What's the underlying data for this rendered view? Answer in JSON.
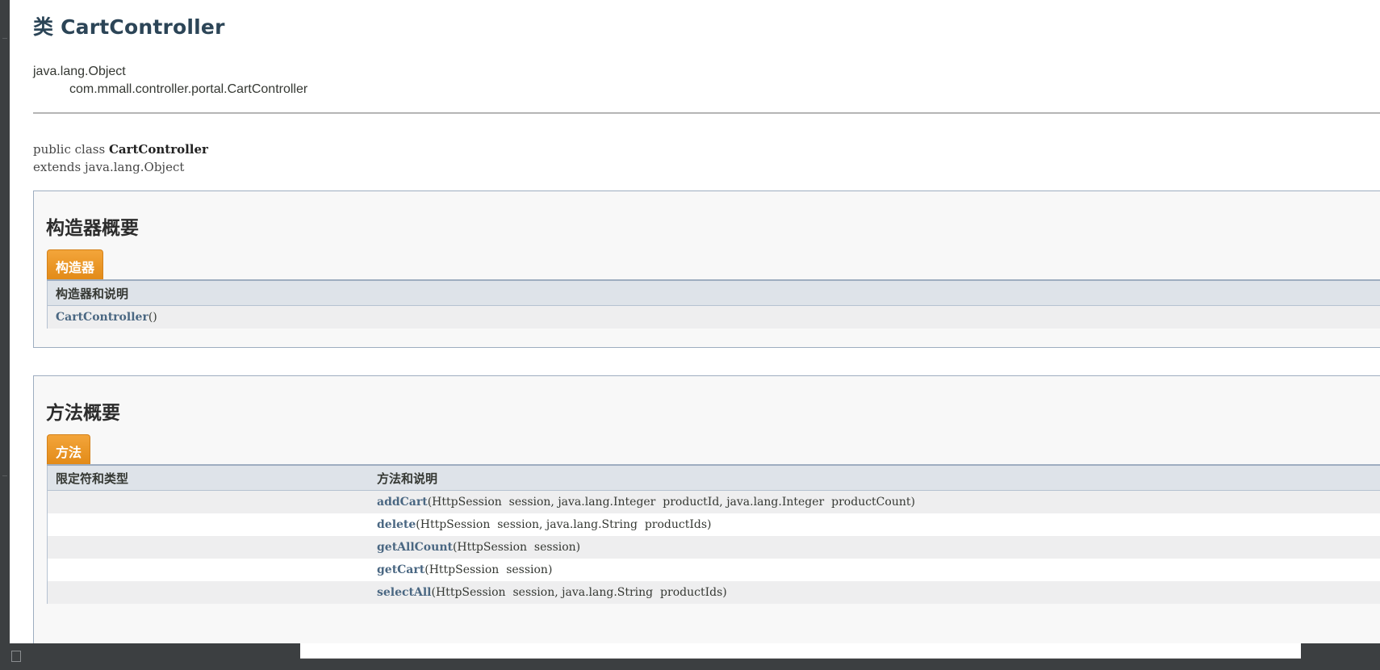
{
  "doc": {
    "title": "类 CartController",
    "inheritance": {
      "root": "java.lang.Object",
      "child": "com.mmall.controller.portal.CartController"
    },
    "signature": {
      "prefix": "public class ",
      "name": "CartController",
      "extends_line": "extends java.lang.Object"
    }
  },
  "constructor_summary": {
    "heading": "构造器概要",
    "tab_label": "构造器",
    "column_header": "构造器和说明",
    "rows": [
      {
        "name": "CartController",
        "params": "()"
      }
    ]
  },
  "method_summary": {
    "heading": "方法概要",
    "tab_label": "方法",
    "column_headers": [
      "限定符和类型",
      "方法和说明"
    ],
    "rows": [
      {
        "modifier": "",
        "name": "addCart",
        "params": "(HttpSession  session, java.lang.Integer  productId, java.lang.Integer  productCount)"
      },
      {
        "modifier": "",
        "name": "delete",
        "params": "(HttpSession  session, java.lang.String  productIds)"
      },
      {
        "modifier": "",
        "name": "getAllCount",
        "params": "(HttpSession  session)"
      },
      {
        "modifier": "",
        "name": "getCart",
        "params": "(HttpSession  session)"
      },
      {
        "modifier": "",
        "name": "selectAll",
        "params": "(HttpSession  session, java.lang.String  productIds)"
      }
    ]
  },
  "colors": {
    "title": "#2c4557",
    "tab_orange": "#e28a17",
    "table_header": "#dee3e9",
    "link": "#4a6782"
  }
}
